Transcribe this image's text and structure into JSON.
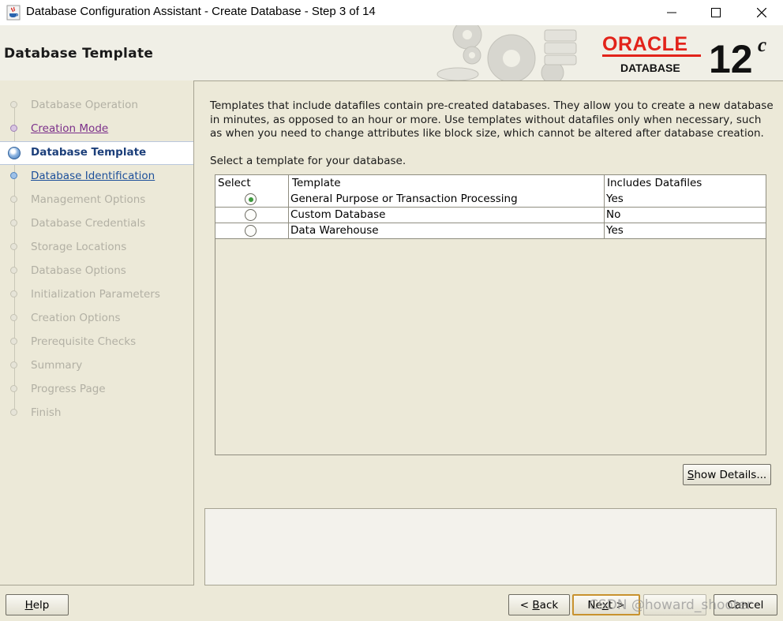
{
  "window": {
    "title": "Database Configuration Assistant - Create Database - Step 3 of 14",
    "controls": [
      "minimize",
      "maximize",
      "close"
    ]
  },
  "header": {
    "title": "Database Template",
    "logo": {
      "brand": "ORACLE",
      "product": "DATABASE",
      "version": "12",
      "version_suffix": "c"
    }
  },
  "sidebar": {
    "steps": [
      {
        "label": "Database Operation",
        "state": "disabled"
      },
      {
        "label": "Creation Mode",
        "state": "visited"
      },
      {
        "label": "Database Template",
        "state": "current"
      },
      {
        "label": "Database Identification",
        "state": "link"
      },
      {
        "label": "Management Options",
        "state": "disabled"
      },
      {
        "label": "Database Credentials",
        "state": "disabled"
      },
      {
        "label": "Storage Locations",
        "state": "disabled"
      },
      {
        "label": "Database Options",
        "state": "disabled"
      },
      {
        "label": "Initialization Parameters",
        "state": "disabled"
      },
      {
        "label": "Creation Options",
        "state": "disabled"
      },
      {
        "label": "Prerequisite Checks",
        "state": "disabled"
      },
      {
        "label": "Summary",
        "state": "disabled"
      },
      {
        "label": "Progress Page",
        "state": "disabled"
      },
      {
        "label": "Finish",
        "state": "disabled"
      }
    ]
  },
  "main": {
    "description": "Templates that include datafiles contain pre-created databases. They allow you to create a new database in minutes, as opposed to an hour or more. Use templates without datafiles only when necessary, such as when you need to change attributes like block size, which cannot be altered after database creation.",
    "select_prompt": "Select a template for your database.",
    "table": {
      "columns": [
        "Select",
        "Template",
        "Includes Datafiles"
      ],
      "rows": [
        {
          "selected": true,
          "template": "General Purpose or Transaction Processing",
          "includes_datafiles": "Yes"
        },
        {
          "selected": false,
          "template": "Custom Database",
          "includes_datafiles": "No"
        },
        {
          "selected": false,
          "template": "Data Warehouse",
          "includes_datafiles": "Yes"
        }
      ]
    },
    "show_details_button": {
      "mnemonic": "S",
      "rest": "how Details..."
    }
  },
  "footer": {
    "help_button": {
      "mnemonic": "H",
      "rest": "elp"
    },
    "back_button": {
      "prefix": "< ",
      "mnemonic": "B",
      "rest": "ack"
    },
    "next_button": {
      "prefix": "Ne",
      "mnemonic": "x",
      "rest": "t >"
    },
    "finish_button": {
      "label": ""
    },
    "cancel_button": {
      "label": "Cancel"
    }
  },
  "watermark": "CSDN @howard_shooter"
}
